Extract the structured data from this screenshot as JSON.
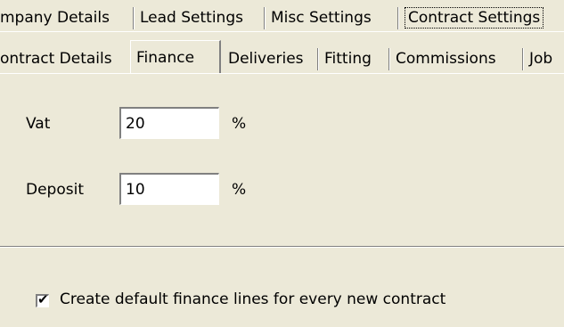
{
  "tabs_top": [
    {
      "label": "mpany Details"
    },
    {
      "label": "Lead Settings"
    },
    {
      "label": "Misc Settings"
    },
    {
      "label": "Contract Settings",
      "selected": true
    }
  ],
  "tabs_second": [
    {
      "label": "ontract Details"
    },
    {
      "label": "Finance",
      "selected": true
    },
    {
      "label": "Deliveries"
    },
    {
      "label": "Fitting"
    },
    {
      "label": "Commissions"
    },
    {
      "label": "Job"
    }
  ],
  "finance": {
    "vat_label": "Vat",
    "vat_value": "20",
    "vat_unit": "%",
    "deposit_label": "Deposit",
    "deposit_value": "10",
    "deposit_unit": "%"
  },
  "options": {
    "default_lines_label": "Create default finance lines for every new contract",
    "default_lines_checked": true,
    "check_glyph": "✔"
  }
}
